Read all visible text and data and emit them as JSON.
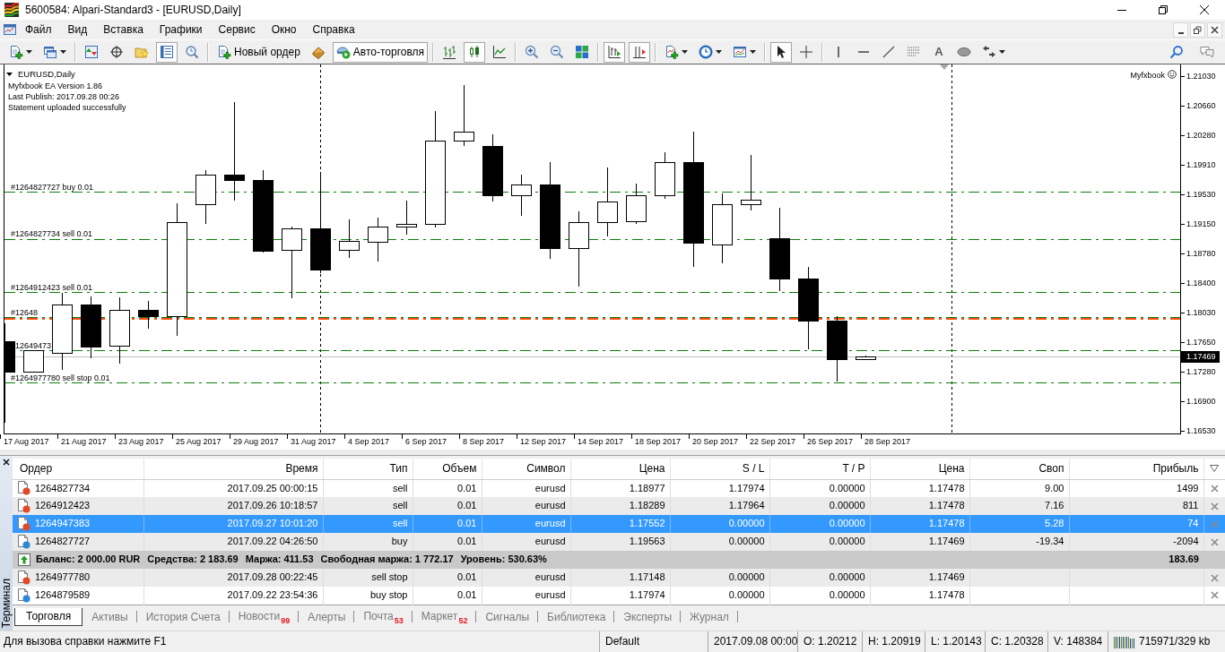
{
  "window": {
    "title": "5600584: Alpari-Standard3 - [EURUSD,Daily]"
  },
  "menu": [
    "Файл",
    "Вид",
    "Вставка",
    "Графики",
    "Сервис",
    "Окно",
    "Справка"
  ],
  "toolbar": [
    [
      {
        "kind": "new-chart",
        "pressed": false,
        "dropdown": true
      },
      {
        "kind": "profiles",
        "pressed": false,
        "dropdown": true
      }
    ],
    [
      {
        "kind": "market-watch",
        "pressed": false,
        "dropdown": false
      },
      {
        "kind": "data-window",
        "pressed": false,
        "dropdown": false
      },
      {
        "kind": "navigator",
        "pressed": false,
        "dropdown": false
      },
      {
        "kind": "terminal",
        "pressed": true,
        "dropdown": false
      },
      {
        "kind": "tester",
        "pressed": false,
        "dropdown": false
      }
    ],
    [
      {
        "kind": "new-order",
        "label": "Новый ордер",
        "pressed": false,
        "dropdown": false
      },
      {
        "kind": "editor",
        "pressed": false,
        "dropdown": false
      },
      {
        "kind": "auto-trading",
        "label": "Авто-торговля",
        "pressed": true,
        "dropdown": false
      }
    ],
    [
      {
        "kind": "bars",
        "pressed": false,
        "dropdown": false
      },
      {
        "kind": "candles",
        "pressed": true,
        "dropdown": false
      },
      {
        "kind": "line",
        "pressed": false,
        "dropdown": false
      }
    ],
    [
      {
        "kind": "zoom-in",
        "pressed": false,
        "dropdown": false
      },
      {
        "kind": "zoom-out",
        "pressed": false,
        "dropdown": false
      },
      {
        "kind": "tile",
        "pressed": false,
        "dropdown": false
      }
    ],
    [
      {
        "kind": "auto-scroll",
        "pressed": true,
        "dropdown": false
      },
      {
        "kind": "chart-shift",
        "pressed": true,
        "dropdown": false
      }
    ],
    [
      {
        "kind": "indicators",
        "pressed": false,
        "dropdown": true
      },
      {
        "kind": "periods",
        "pressed": false,
        "dropdown": true
      },
      {
        "kind": "templates",
        "pressed": false,
        "dropdown": true
      }
    ],
    [
      {
        "kind": "cursor",
        "pressed": true,
        "dropdown": false
      },
      {
        "kind": "crosshair",
        "pressed": false,
        "dropdown": false
      }
    ],
    [
      {
        "kind": "vline",
        "pressed": false,
        "dropdown": false
      },
      {
        "kind": "hline",
        "pressed": false,
        "dropdown": false
      },
      {
        "kind": "trendline",
        "pressed": false,
        "dropdown": false
      },
      {
        "kind": "fibo",
        "pressed": false,
        "dropdown": false
      },
      {
        "kind": "text",
        "label": "A",
        "pressed": false,
        "dropdown": false
      },
      {
        "kind": "ellipse",
        "pressed": false,
        "dropdown": false
      },
      {
        "kind": "arrows",
        "pressed": false,
        "dropdown": true
      }
    ]
  ],
  "toolbar_right": [
    {
      "kind": "search"
    },
    {
      "kind": "chat"
    }
  ],
  "chart": {
    "symbol": "EURUSD,Daily",
    "info": [
      "Myfxbook EA Version 1.86",
      "Last Publish: 2017.09.28 00:26",
      "Statement uploaded successfully"
    ],
    "brand": "Myfxbook",
    "order_labels": [
      "#1264827727 buy 0.01",
      "#1264827734 sell 0.01",
      "#1264912423 sell 0.01",
      "#12648",
      "12649473",
      "#1264977780 sell stop 0.01"
    ],
    "price_labels": [
      "1.21030",
      "1.20660",
      "1.20280",
      "1.19910",
      "1.19530",
      "1.19150",
      "1.18780",
      "1.18400",
      "1.18030",
      "1.17650",
      "1.17280",
      "1.16900",
      "1.16530"
    ],
    "current_price": "1.17469",
    "dates": [
      "17 Aug 2017",
      "21 Aug 2017",
      "23 Aug 2017",
      "25 Aug 2017",
      "29 Aug 2017",
      "31 Aug 2017",
      "4 Sep 2017",
      "6 Sep 2017",
      "8 Sep 2017",
      "12 Sep 2017",
      "14 Sep 2017",
      "18 Sep 2017",
      "20 Sep 2017",
      "22 Sep 2017",
      "26 Sep 2017",
      "28 Sep 2017"
    ]
  },
  "terminal": {
    "title": "Терминал",
    "columns": [
      "Ордер",
      "Время",
      "Тип",
      "Объем",
      "Символ",
      "Цена",
      "S / L",
      "T / P",
      "Цена",
      "Своп",
      "Прибыль"
    ],
    "positions": [
      {
        "order": "1264827734",
        "time": "2017.09.25 00:00:15",
        "type": "sell",
        "volume": "0.01",
        "symbol": "eurusd",
        "open_price": "1.18977",
        "sl": "1.17974",
        "tp": "0.00000",
        "price": "1.17478",
        "swap": "9.00",
        "profit": "1499",
        "color": "#e2492b",
        "selected": false
      },
      {
        "order": "1264912423",
        "time": "2017.09.26 10:18:57",
        "type": "sell",
        "volume": "0.01",
        "symbol": "eurusd",
        "open_price": "1.18289",
        "sl": "1.17964",
        "tp": "0.00000",
        "price": "1.17478",
        "swap": "7.16",
        "profit": "811",
        "color": "#e2492b",
        "selected": false
      },
      {
        "order": "1264947383",
        "time": "2017.09.27 10:01:20",
        "type": "sell",
        "volume": "0.01",
        "symbol": "eurusd",
        "open_price": "1.17552",
        "sl": "0.00000",
        "tp": "0.00000",
        "price": "1.17478",
        "swap": "5.28",
        "profit": "74",
        "color": "#e2492b",
        "selected": true
      },
      {
        "order": "1264827727",
        "time": "2017.09.22 04:26:50",
        "type": "buy",
        "volume": "0.01",
        "symbol": "eurusd",
        "open_price": "1.19563",
        "sl": "0.00000",
        "tp": "0.00000",
        "price": "1.17469",
        "swap": "-19.34",
        "profit": "-2094",
        "color": "#2f86d6",
        "selected": false
      }
    ],
    "summary": {
      "items": [
        "Баланс: 2 000.00 RUR",
        "Средства: 2 183.69",
        "Маржа: 411.53",
        "Свободная маржа: 1 772.17",
        "Уровень: 530.63%"
      ],
      "profit": "183.69"
    },
    "pending": [
      {
        "order": "1264977780",
        "time": "2017.09.28 00:22:45",
        "type": "sell stop",
        "volume": "0.01",
        "symbol": "eurusd",
        "open_price": "1.17148",
        "sl": "0.00000",
        "tp": "0.00000",
        "price": "1.17469",
        "color": "#e2492b",
        "selected": false
      },
      {
        "order": "1264879589",
        "time": "2017.09.22 23:54:36",
        "type": "buy stop",
        "volume": "0.01",
        "symbol": "eurusd",
        "open_price": "1.17974",
        "sl": "0.00000",
        "tp": "0.00000",
        "price": "1.17478",
        "color": "#2f86d6",
        "selected": false
      }
    ],
    "tabs": [
      {
        "label": "Торговля",
        "selected": true
      },
      {
        "label": "Активы",
        "selected": false
      },
      {
        "label": "История Счета",
        "selected": false
      },
      {
        "label": "Новости",
        "count": "99",
        "selected": false
      },
      {
        "label": "Алерты",
        "selected": false
      },
      {
        "label": "Почта",
        "count": "53",
        "selected": false
      },
      {
        "label": "Маркет",
        "count": "52",
        "selected": false
      },
      {
        "label": "Сигналы",
        "selected": false
      },
      {
        "label": "Библиотека",
        "selected": false
      },
      {
        "label": "Эксперты",
        "selected": false
      },
      {
        "label": "Журнал",
        "selected": false
      }
    ]
  },
  "status_bar": {
    "help": "Для вызова справки нажмите F1",
    "fields": [
      "Default",
      "2017.09.08 00:00",
      "O: 1.20212",
      "H: 1.20919",
      "L: 1.20143",
      "C: 1.20328",
      "V: 148384"
    ],
    "traffic": "715971/329 kb"
  }
}
